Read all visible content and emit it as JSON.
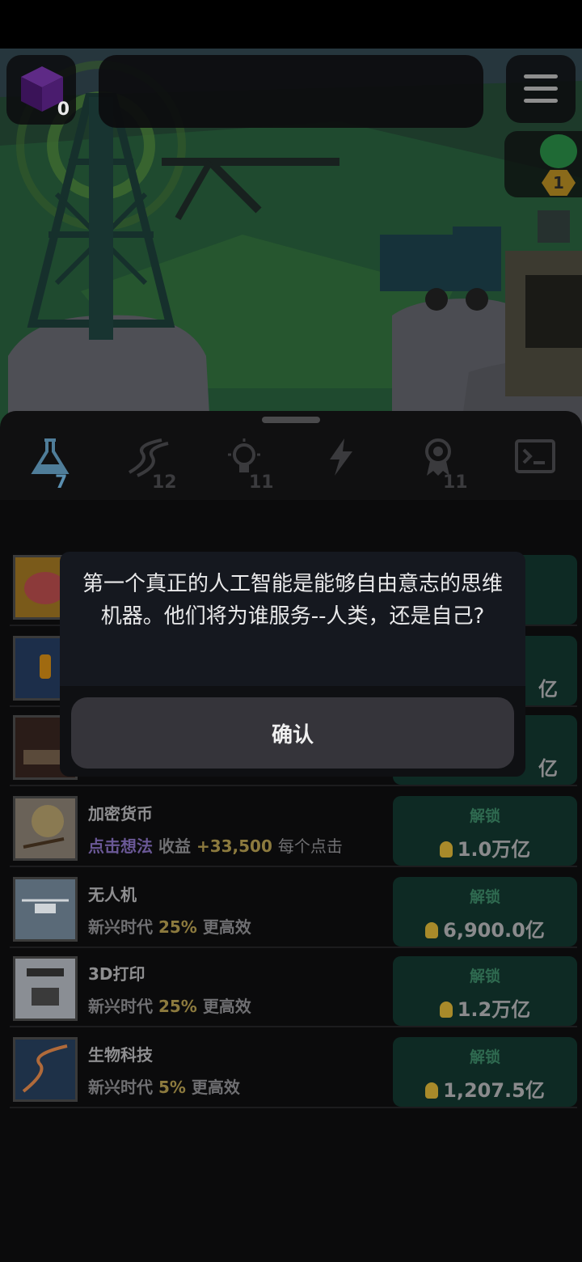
{
  "hud": {
    "cube_count": "0",
    "dino_level": "1"
  },
  "tabs": [
    {
      "icon": "flask-icon",
      "count": "7",
      "active": true
    },
    {
      "icon": "dna-icon",
      "count": "12"
    },
    {
      "icon": "lightbulb-icon",
      "count": "11"
    },
    {
      "icon": "lightning-icon",
      "count": ""
    },
    {
      "icon": "award-icon",
      "count": "11"
    },
    {
      "icon": "terminal-icon",
      "count": ""
    }
  ],
  "dialog": {
    "message": "第一个真正的人工智能是能够自由意志的思维机器。他们将为谁服务--人类，还是自己?",
    "confirm_label": "确认"
  },
  "partial_costs": [
    "亿",
    "亿"
  ],
  "rows": [
    {
      "name": "加密货币",
      "desc_a": "点击想法",
      "desc_b": "收益",
      "desc_c": "+33,500",
      "desc_d": "每个点击",
      "unlock_label": "解锁",
      "cost": "1.0万亿"
    },
    {
      "name": "无人机",
      "desc_a": "新兴时代",
      "desc_c": "25%",
      "desc_d": "更高效",
      "unlock_label": "解锁",
      "cost": "6,900.0亿"
    },
    {
      "name": "3D打印",
      "desc_a": "新兴时代",
      "desc_c": "25%",
      "desc_d": "更高效",
      "unlock_label": "解锁",
      "cost": "1.2万亿"
    },
    {
      "name": "生物科技",
      "desc_a": "新兴时代",
      "desc_c": "5%",
      "desc_d": "更高效",
      "unlock_label": "解锁",
      "cost": "1,207.5亿"
    }
  ]
}
